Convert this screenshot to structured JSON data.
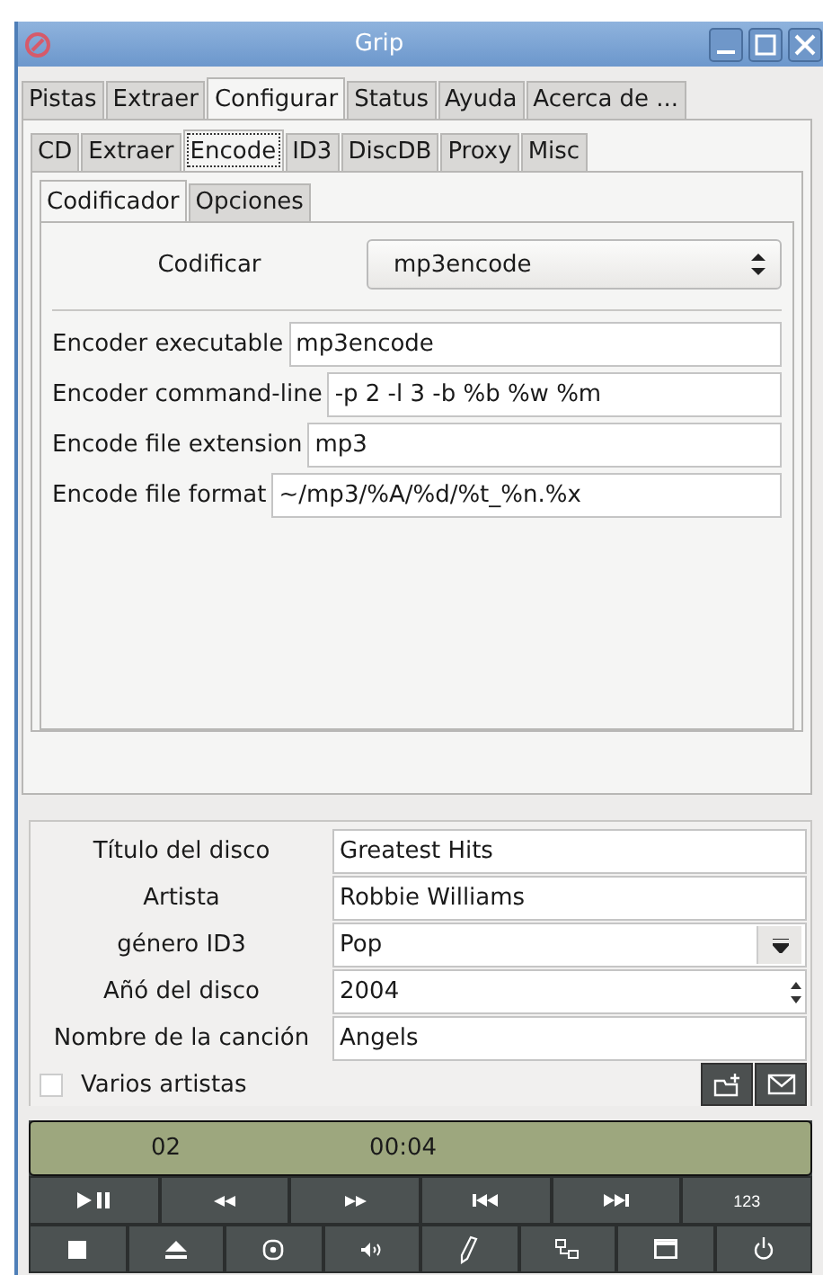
{
  "window": {
    "title": "Grip"
  },
  "tabs": [
    {
      "label": "Pistas",
      "selected": false
    },
    {
      "label": "Extraer",
      "selected": false
    },
    {
      "label": "Configurar",
      "selected": true
    },
    {
      "label": "Status",
      "selected": false
    },
    {
      "label": "Ayuda",
      "selected": false
    },
    {
      "label": "Acerca de ...",
      "selected": false
    }
  ],
  "subtabs": [
    {
      "label": "CD",
      "selected": false
    },
    {
      "label": "Extraer",
      "selected": false
    },
    {
      "label": "Encode",
      "selected": true
    },
    {
      "label": "ID3",
      "selected": false
    },
    {
      "label": "DiscDB",
      "selected": false
    },
    {
      "label": "Proxy",
      "selected": false
    },
    {
      "label": "Misc",
      "selected": false
    }
  ],
  "encode_tabs": [
    {
      "label": "Codificador",
      "selected": true
    },
    {
      "label": "Opciones",
      "selected": false
    }
  ],
  "encoder_select": {
    "label": "Codificar",
    "value": "mp3encode"
  },
  "encoder_fields": [
    {
      "label": "Encoder executable",
      "value": "mp3encode"
    },
    {
      "label": "Encoder command-line",
      "value": "-p 2 -l 3 -b %b %w %m"
    },
    {
      "label": "Encode file extension",
      "value": "mp3"
    },
    {
      "label": "Encode file format",
      "value": "~/mp3/%A/%d/%t_%n.%x"
    }
  ],
  "disc_fields": [
    {
      "label": "Título del disco",
      "value": "Greatest Hits",
      "kind": "text"
    },
    {
      "label": "Artista",
      "value": "Robbie Williams",
      "kind": "text"
    },
    {
      "label": "género ID3",
      "value": "Pop",
      "kind": "combo"
    },
    {
      "label": "Añó del disco",
      "value": "2004",
      "kind": "spin"
    },
    {
      "label": "Nombre de la canción",
      "value": "Angels",
      "kind": "text"
    }
  ],
  "various_artists": {
    "label": "Varios artistas",
    "checked": false
  },
  "display": {
    "track": "02",
    "time": "00:04"
  },
  "controls_row1": [
    {
      "kind": "playpause"
    },
    {
      "kind": "rewind"
    },
    {
      "kind": "forward"
    },
    {
      "kind": "prev"
    },
    {
      "kind": "next"
    },
    {
      "kind": "text",
      "label": "123"
    }
  ],
  "controls_row2": [
    {
      "kind": "stop"
    },
    {
      "kind": "eject"
    },
    {
      "kind": "disc"
    },
    {
      "kind": "volume"
    },
    {
      "kind": "pen"
    },
    {
      "kind": "network"
    },
    {
      "kind": "window"
    },
    {
      "kind": "power"
    }
  ]
}
